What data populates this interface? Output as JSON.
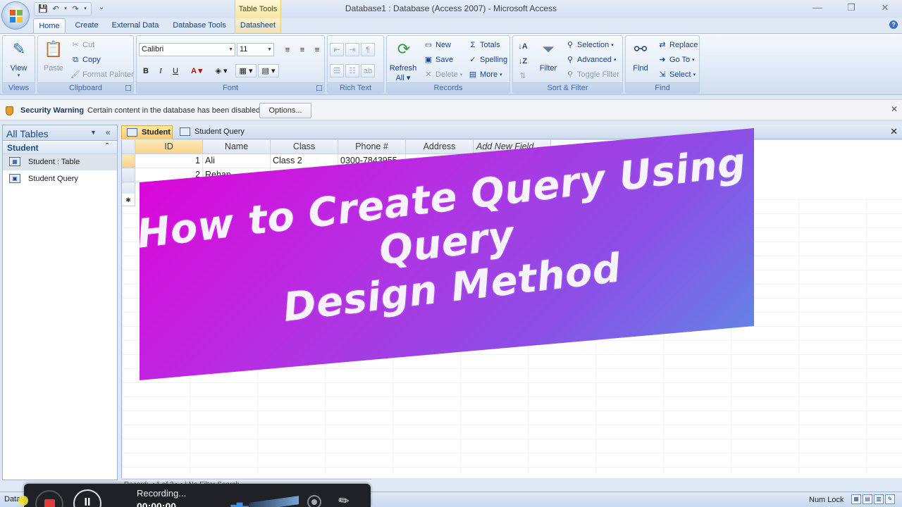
{
  "window": {
    "title": "Database1 : Database (Access 2007)  -  Microsoft Access",
    "context_tab_group": "Table Tools",
    "controls": [
      "—",
      "❐",
      "✕"
    ]
  },
  "ribbon_tabs": [
    "Home",
    "Create",
    "External Data",
    "Database Tools",
    "Datasheet"
  ],
  "ribbon": {
    "views": {
      "view": "View",
      "group": "Views"
    },
    "clipboard": {
      "paste": "Paste",
      "cut": "Cut",
      "copy": "Copy",
      "format_painter": "Format Painter",
      "group": "Clipboard"
    },
    "font": {
      "face": "Calibri",
      "size": "11",
      "bold": "B",
      "italic": "I",
      "underline": "U",
      "group": "Font"
    },
    "rich_text": {
      "group": "Rich Text"
    },
    "records": {
      "refresh": "Refresh",
      "refresh_sub": "All",
      "new": "New",
      "save": "Save",
      "delete": "Delete",
      "totals": "Totals",
      "spelling": "Spelling",
      "more": "More",
      "group": "Records"
    },
    "sort_filter": {
      "filter": "Filter",
      "selection": "Selection",
      "advanced": "Advanced",
      "toggle_filter": "Toggle Filter",
      "group": "Sort & Filter"
    },
    "find": {
      "find": "Find",
      "replace": "Replace",
      "goto": "Go To",
      "select": "Select",
      "group": "Find"
    }
  },
  "security": {
    "title": "Security Warning",
    "message": "Certain content in the database has been disabled",
    "options": "Options..."
  },
  "nav_pane": {
    "title": "All Tables",
    "group": "Student",
    "items": [
      {
        "label": "Student : Table",
        "icon": "table-icon"
      },
      {
        "label": "Student Query",
        "icon": "query-icon"
      }
    ]
  },
  "doc_tabs": [
    "Student",
    "Student Query"
  ],
  "datasheet": {
    "columns": [
      "ID",
      "Name",
      "Class",
      "Phone #",
      "Address",
      "Add New Field"
    ],
    "rows": [
      {
        "id": "1",
        "name": "Ali",
        "class": "Class 2",
        "phone": "0300-7843955"
      },
      {
        "id": "2",
        "name": "Rehan",
        "class": "",
        "phone": ""
      }
    ],
    "new_row_marker": "✱"
  },
  "record_nav": "Record: ◂   1 of 2   ▸ ▸|   No Filter   Search",
  "status": {
    "left": "Datasheet View",
    "num_lock": "Num Lock"
  },
  "recorder": {
    "status": "Recording...",
    "time": "00:00:00"
  },
  "banner": {
    "line1": "How to Create Query Using Query",
    "line2": "Design Method"
  }
}
